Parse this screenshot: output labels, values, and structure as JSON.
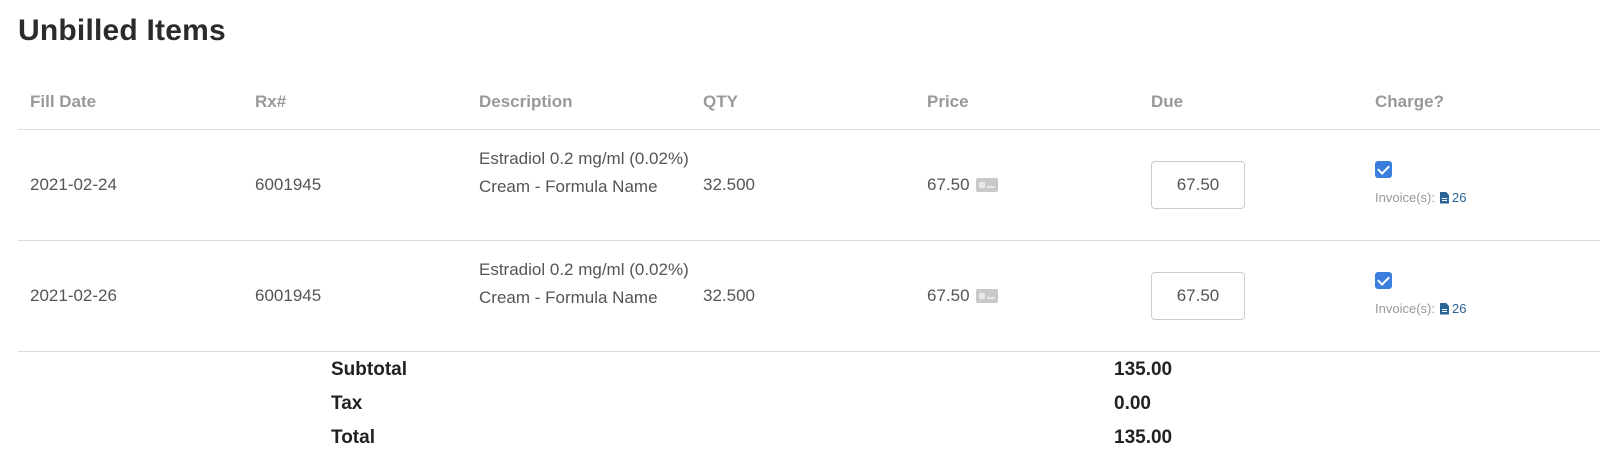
{
  "page": {
    "title": "Unbilled Items"
  },
  "table": {
    "headers": {
      "fill_date": "Fill Date",
      "rx": "Rx#",
      "description": "Description",
      "qty": "QTY",
      "price": "Price",
      "due": "Due",
      "charge": "Charge?"
    },
    "rows": [
      {
        "fill_date": "2021-02-24",
        "rx": "6001945",
        "description": "Estradiol 0.2 mg/ml (0.02%) Cream - Formula Name",
        "qty": "32.500",
        "price": "67.50",
        "price_icon": "credit-card-icon",
        "due_value": "67.50",
        "charge_checked": true,
        "invoice_label": "Invoice(s):",
        "invoice_icon": "file-icon",
        "invoice_number": "26"
      },
      {
        "fill_date": "2021-02-26",
        "rx": "6001945",
        "description": "Estradiol 0.2 mg/ml (0.02%) Cream - Formula Name",
        "qty": "32.500",
        "price": "67.50",
        "price_icon": "credit-card-icon",
        "due_value": "67.50",
        "charge_checked": true,
        "invoice_label": "Invoice(s):",
        "invoice_icon": "file-icon",
        "invoice_number": "26"
      }
    ]
  },
  "totals": {
    "subtotal_label": "Subtotal",
    "subtotal_value": "135.00",
    "tax_label": "Tax",
    "tax_value": "0.00",
    "total_label": "Total",
    "total_value": "135.00"
  },
  "colors": {
    "accent": "#3b7fde",
    "link": "#2a6496",
    "header_text": "#999999",
    "divider": "#dcdcdc"
  }
}
